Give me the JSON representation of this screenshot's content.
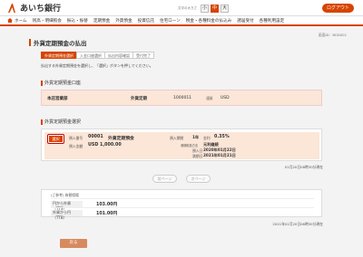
{
  "header": {
    "logo_text": "あいち銀行",
    "font_size_label": "文字の大きさ",
    "font_sizes": [
      "小",
      "中",
      "大"
    ],
    "logout_label": "ログアウト"
  },
  "nav": {
    "items": [
      "ホーム",
      "残高・明細照会",
      "振込・振替",
      "定期預金",
      "外貨預金",
      "投資信託",
      "住宅ローン",
      "税金・各種料金の払込み",
      "諸届受付",
      "各種利用設定"
    ]
  },
  "screen_id": "画面ID：BGD001",
  "page_title": "外貨定期預金の払出",
  "steps": [
    "外貨定期預金選択",
    "入金口座選択",
    "払出内容確認",
    "受付完了"
  ],
  "instruction": "払出する外貨定期預金を選択し、「選択」ボタンを押してください。",
  "account_section": {
    "heading": "外貨定期預金口座",
    "branch": "本店営業部",
    "type": "外貨定期",
    "number": "1000011",
    "currency_label": "通貨",
    "currency": "USD"
  },
  "deposit_section": {
    "heading": "外貨定期預金選択",
    "select_label": "選択",
    "deposit_no_label": "預入番号",
    "deposit_no": "00001",
    "deposit_type": "外貨定期預金",
    "amount_label": "預入金額",
    "amount": "USD 1,000.00",
    "period_label": "預入期間",
    "period": "1年",
    "rate_label": "金利",
    "rate": "0.35%",
    "maturity_method_label": "満期取扱方法",
    "maturity_method": "元利継続",
    "deposit_date_label": "預入日",
    "deposit_date": "2020年01月22日",
    "maturity_date_label": "満期日",
    "maturity_date": "2021年01月21日"
  },
  "count_text": "01月20日08時30分現在",
  "pager": {
    "prev": "前ページ",
    "next": "次ページ"
  },
  "rates": {
    "heading": "(ご参考) 為替相場",
    "tts_label": "円から外貨（TTS）",
    "tts_value": "103.00円",
    "ttb_label": "外貨から円（TTB）",
    "ttb_value": "101.00円",
    "timestamp": "2021年01月20日08時30分現在"
  },
  "back_label": "戻る",
  "colors": {
    "accent": "#d64400",
    "highlight": "#fbe6d8"
  }
}
